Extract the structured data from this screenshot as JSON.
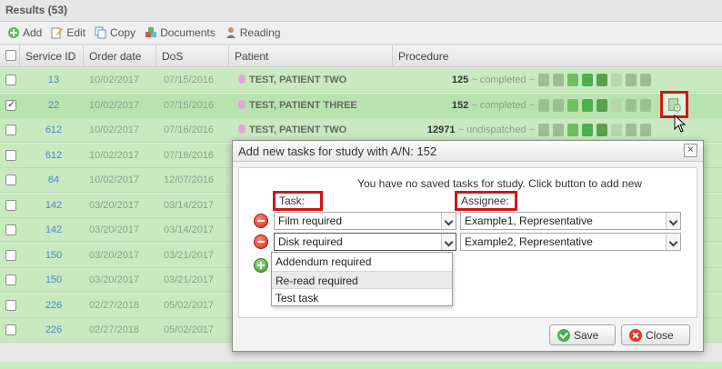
{
  "header": {
    "title": "Results (53)"
  },
  "toolbar": {
    "add": "Add",
    "edit": "Edit",
    "copy": "Copy",
    "documents": "Documents",
    "reading": "Reading"
  },
  "columns": [
    "Service ID",
    "Order date",
    "DoS",
    "Patient",
    "Procedure"
  ],
  "rows": [
    {
      "id": "13",
      "order": "10/02/2017",
      "dos": "07/15/2016",
      "patient": "TEST, PATIENT TWO",
      "proc": "125",
      "status": "completed",
      "checked": false
    },
    {
      "id": "22",
      "order": "10/02/2017",
      "dos": "07/15/2016",
      "patient": "TEST, PATIENT THREE",
      "proc": "152",
      "status": "completed",
      "checked": true
    },
    {
      "id": "612",
      "order": "10/02/2017",
      "dos": "07/16/2016",
      "patient": "TEST, PATIENT TWO",
      "proc": "12971",
      "status": "undispatched",
      "checked": false
    },
    {
      "id": "612",
      "order": "10/02/2017",
      "dos": "07/16/2016",
      "patient": "",
      "proc": "",
      "status": "",
      "checked": false
    },
    {
      "id": "64",
      "order": "10/02/2017",
      "dos": "12/07/2016",
      "patient": "",
      "proc": "",
      "status": "",
      "checked": false
    },
    {
      "id": "142",
      "order": "03/20/2017",
      "dos": "03/14/2017",
      "patient": "",
      "proc": "",
      "status": "",
      "checked": false
    },
    {
      "id": "142",
      "order": "03/20/2017",
      "dos": "03/14/2017",
      "patient": "",
      "proc": "",
      "status": "",
      "checked": false
    },
    {
      "id": "150",
      "order": "03/20/2017",
      "dos": "03/21/2017",
      "patient": "",
      "proc": "",
      "status": "",
      "checked": false
    },
    {
      "id": "150",
      "order": "03/20/2017",
      "dos": "03/21/2017",
      "patient": "",
      "proc": "",
      "status": "",
      "checked": false
    },
    {
      "id": "226",
      "order": "02/27/2018",
      "dos": "05/02/2017",
      "patient": "",
      "proc": "",
      "status": "",
      "checked": false
    },
    {
      "id": "226",
      "order": "02/27/2018",
      "dos": "05/02/2017",
      "patient": "",
      "proc": "",
      "status": "",
      "checked": false
    }
  ],
  "modal": {
    "title": "Add new tasks for study with A/N: 152",
    "message": "You have no saved tasks for study. Click button to add new",
    "task_label": "Task:",
    "assignee_label": "Assignee:",
    "tasks": [
      {
        "task": "Film required",
        "assignee": "Example1, Representative"
      },
      {
        "task": "Disk required",
        "assignee": "Example2, Representative"
      }
    ],
    "dropdown_options": [
      "Addendum required",
      "Re-read required",
      "Test task"
    ],
    "save": "Save",
    "close": "Close",
    "close_x": "×"
  },
  "colors": {
    "row_bg": "#c9eac1",
    "highlight": "#d01616",
    "id_link": "#4a86c6"
  }
}
